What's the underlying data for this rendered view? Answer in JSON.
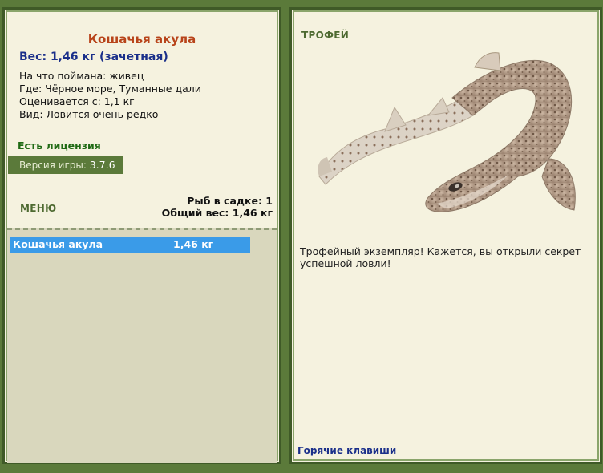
{
  "fish": {
    "title": "Кошачья акула",
    "weight_line": "Вес: 1,46 кг (зачетная)",
    "bait_line": "На что поймана: живец",
    "place_line": "Где: Чёрное море, Туманные дали",
    "price_line": "Оценивается с: 1,1 кг",
    "kind_line": "Вид: Ловится очень редко"
  },
  "license": "Есть лицензия",
  "version": {
    "label": "Версия игры:",
    "value": "3.7.6"
  },
  "menu": {
    "label": "МЕНЮ"
  },
  "keepnet": {
    "count_line": "Рыб в садке: 1",
    "weight_line": "Общий вес: 1,46 кг"
  },
  "catch_list": [
    {
      "name": "Кошачья акула",
      "weight": "1,46 кг"
    }
  ],
  "trophy": {
    "label": "ТРОФЕЙ",
    "text": "Трофейный экземпляр! Кажется, вы открыли секрет успешной ловли!"
  },
  "hotkeys_link": "Горячие клавиши",
  "colors": {
    "frame": "#5b7a3a",
    "panel": "#f5f2df",
    "title": "#b8441a",
    "weight": "#1a2f8a",
    "license": "#1f6a14",
    "selection": "#3a9be8"
  },
  "icons": {
    "trophy_image": "shark-image"
  }
}
